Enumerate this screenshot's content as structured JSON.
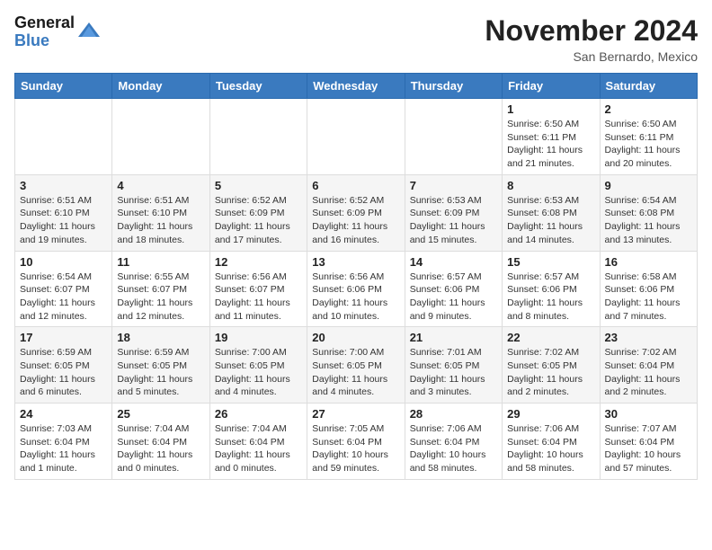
{
  "header": {
    "logo_line1": "General",
    "logo_line2": "Blue",
    "month": "November 2024",
    "location": "San Bernardo, Mexico"
  },
  "weekdays": [
    "Sunday",
    "Monday",
    "Tuesday",
    "Wednesday",
    "Thursday",
    "Friday",
    "Saturday"
  ],
  "weeks": [
    [
      {
        "day": "",
        "info": ""
      },
      {
        "day": "",
        "info": ""
      },
      {
        "day": "",
        "info": ""
      },
      {
        "day": "",
        "info": ""
      },
      {
        "day": "",
        "info": ""
      },
      {
        "day": "1",
        "info": "Sunrise: 6:50 AM\nSunset: 6:11 PM\nDaylight: 11 hours\nand 21 minutes."
      },
      {
        "day": "2",
        "info": "Sunrise: 6:50 AM\nSunset: 6:11 PM\nDaylight: 11 hours\nand 20 minutes."
      }
    ],
    [
      {
        "day": "3",
        "info": "Sunrise: 6:51 AM\nSunset: 6:10 PM\nDaylight: 11 hours\nand 19 minutes."
      },
      {
        "day": "4",
        "info": "Sunrise: 6:51 AM\nSunset: 6:10 PM\nDaylight: 11 hours\nand 18 minutes."
      },
      {
        "day": "5",
        "info": "Sunrise: 6:52 AM\nSunset: 6:09 PM\nDaylight: 11 hours\nand 17 minutes."
      },
      {
        "day": "6",
        "info": "Sunrise: 6:52 AM\nSunset: 6:09 PM\nDaylight: 11 hours\nand 16 minutes."
      },
      {
        "day": "7",
        "info": "Sunrise: 6:53 AM\nSunset: 6:09 PM\nDaylight: 11 hours\nand 15 minutes."
      },
      {
        "day": "8",
        "info": "Sunrise: 6:53 AM\nSunset: 6:08 PM\nDaylight: 11 hours\nand 14 minutes."
      },
      {
        "day": "9",
        "info": "Sunrise: 6:54 AM\nSunset: 6:08 PM\nDaylight: 11 hours\nand 13 minutes."
      }
    ],
    [
      {
        "day": "10",
        "info": "Sunrise: 6:54 AM\nSunset: 6:07 PM\nDaylight: 11 hours\nand 12 minutes."
      },
      {
        "day": "11",
        "info": "Sunrise: 6:55 AM\nSunset: 6:07 PM\nDaylight: 11 hours\nand 12 minutes."
      },
      {
        "day": "12",
        "info": "Sunrise: 6:56 AM\nSunset: 6:07 PM\nDaylight: 11 hours\nand 11 minutes."
      },
      {
        "day": "13",
        "info": "Sunrise: 6:56 AM\nSunset: 6:06 PM\nDaylight: 11 hours\nand 10 minutes."
      },
      {
        "day": "14",
        "info": "Sunrise: 6:57 AM\nSunset: 6:06 PM\nDaylight: 11 hours\nand 9 minutes."
      },
      {
        "day": "15",
        "info": "Sunrise: 6:57 AM\nSunset: 6:06 PM\nDaylight: 11 hours\nand 8 minutes."
      },
      {
        "day": "16",
        "info": "Sunrise: 6:58 AM\nSunset: 6:06 PM\nDaylight: 11 hours\nand 7 minutes."
      }
    ],
    [
      {
        "day": "17",
        "info": "Sunrise: 6:59 AM\nSunset: 6:05 PM\nDaylight: 11 hours\nand 6 minutes."
      },
      {
        "day": "18",
        "info": "Sunrise: 6:59 AM\nSunset: 6:05 PM\nDaylight: 11 hours\nand 5 minutes."
      },
      {
        "day": "19",
        "info": "Sunrise: 7:00 AM\nSunset: 6:05 PM\nDaylight: 11 hours\nand 4 minutes."
      },
      {
        "day": "20",
        "info": "Sunrise: 7:00 AM\nSunset: 6:05 PM\nDaylight: 11 hours\nand 4 minutes."
      },
      {
        "day": "21",
        "info": "Sunrise: 7:01 AM\nSunset: 6:05 PM\nDaylight: 11 hours\nand 3 minutes."
      },
      {
        "day": "22",
        "info": "Sunrise: 7:02 AM\nSunset: 6:05 PM\nDaylight: 11 hours\nand 2 minutes."
      },
      {
        "day": "23",
        "info": "Sunrise: 7:02 AM\nSunset: 6:04 PM\nDaylight: 11 hours\nand 2 minutes."
      }
    ],
    [
      {
        "day": "24",
        "info": "Sunrise: 7:03 AM\nSunset: 6:04 PM\nDaylight: 11 hours\nand 1 minute."
      },
      {
        "day": "25",
        "info": "Sunrise: 7:04 AM\nSunset: 6:04 PM\nDaylight: 11 hours\nand 0 minutes."
      },
      {
        "day": "26",
        "info": "Sunrise: 7:04 AM\nSunset: 6:04 PM\nDaylight: 11 hours\nand 0 minutes."
      },
      {
        "day": "27",
        "info": "Sunrise: 7:05 AM\nSunset: 6:04 PM\nDaylight: 10 hours\nand 59 minutes."
      },
      {
        "day": "28",
        "info": "Sunrise: 7:06 AM\nSunset: 6:04 PM\nDaylight: 10 hours\nand 58 minutes."
      },
      {
        "day": "29",
        "info": "Sunrise: 7:06 AM\nSunset: 6:04 PM\nDaylight: 10 hours\nand 58 minutes."
      },
      {
        "day": "30",
        "info": "Sunrise: 7:07 AM\nSunset: 6:04 PM\nDaylight: 10 hours\nand 57 minutes."
      }
    ]
  ]
}
